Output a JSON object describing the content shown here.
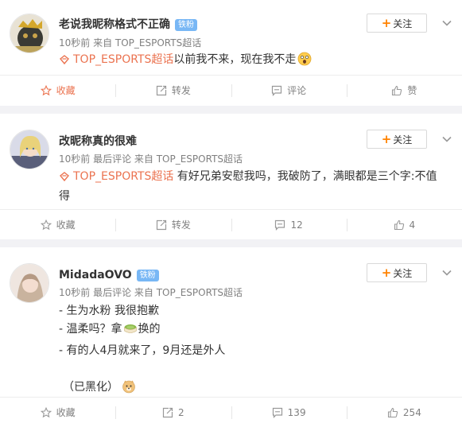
{
  "posts": [
    {
      "username": "老说我昵称格式不正确",
      "badge": "铁粉",
      "meta": "10秒前 来自 TOP_ESPORTS超话",
      "follow_label": "关注",
      "topic": "TOP_ESPORTS超话",
      "text": "以前我不来，现在我不走",
      "actions": {
        "favorite": "收藏",
        "repost": "转发",
        "comment": "评论",
        "like": "赞"
      }
    },
    {
      "username": "改昵称真的很难",
      "meta": "10秒前 最后评论 来自 TOP_ESPORTS超话",
      "follow_label": "关注",
      "topic": "TOP_ESPORTS超话",
      "text_line1": " 有好兄弟安慰我吗，我破防了，满眼都是三个字:不值",
      "text_line2": "得",
      "actions": {
        "favorite": "收藏",
        "repost": "转发",
        "comment": "12",
        "like": "4"
      }
    },
    {
      "username": "MidadaOVO",
      "badge": "铁粉",
      "meta": "10秒前 最后评论 来自 TOP_ESPORTS超话",
      "follow_label": "关注",
      "lines": [
        "- 生为水粉 我很抱歉",
        "- 温柔吗？拿",
        "换的",
        "- 有的人4月就来了，9月还是外人",
        "（已黑化）"
      ],
      "actions": {
        "favorite": "收藏",
        "repost": "2",
        "comment": "139",
        "like": "254"
      }
    }
  ],
  "colors": {
    "accent": "#ff8200",
    "topic": "#eb7350",
    "badge": "#78b7f5",
    "background": "#f2f2f5"
  },
  "icons": [
    "star-icon",
    "repost-icon",
    "comment-icon",
    "like-icon",
    "chevron-down-icon",
    "plus-icon",
    "super-topic-icon"
  ]
}
